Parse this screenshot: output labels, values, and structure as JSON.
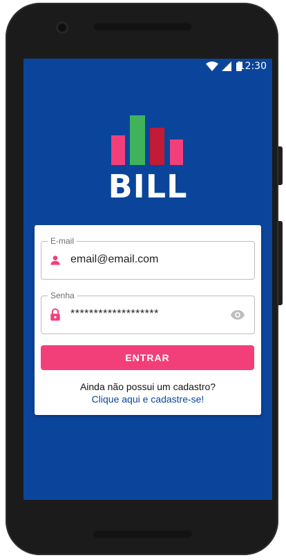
{
  "status_bar": {
    "time": "12:30",
    "icons": [
      "wifi-icon",
      "cellular-signal-icon",
      "battery-icon"
    ]
  },
  "branding": {
    "app_name": "BILL",
    "logo_bars": [
      {
        "color": "#f23f7a",
        "level": 0.6
      },
      {
        "color": "#3fb35a",
        "level": 1.0
      },
      {
        "color": "#c21b36",
        "level": 0.75
      },
      {
        "color": "#f23f7a",
        "level": 0.52
      }
    ]
  },
  "login_form": {
    "email": {
      "label": "E-mail",
      "value": "email@email.com",
      "icon": "person-icon"
    },
    "password": {
      "label": "Senha",
      "value": "*******************",
      "icon": "lock-icon",
      "toggle_icon": "eye-icon"
    },
    "submit_label": "ENTRAR",
    "signup_prompt": "Ainda não possui um cadastro?",
    "signup_link": "Clique aqui e cadastre-se!"
  },
  "colors": {
    "background": "#0a459b",
    "accent": "#f23f7a",
    "link": "#0a459b"
  }
}
